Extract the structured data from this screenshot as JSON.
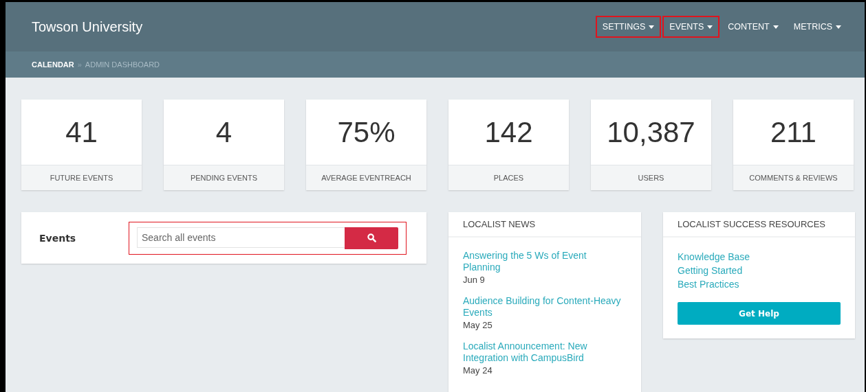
{
  "header": {
    "title": "Towson University",
    "nav": [
      {
        "label": "SETTINGS",
        "highlighted": true
      },
      {
        "label": "EVENTS",
        "highlighted": true
      },
      {
        "label": "CONTENT",
        "highlighted": false
      },
      {
        "label": "METRICS",
        "highlighted": false
      }
    ]
  },
  "breadcrumb": {
    "items": [
      "CALENDAR",
      "ADMIN DASHBOARD"
    ],
    "separator": "»"
  },
  "stats": [
    {
      "value": "41",
      "label": "FUTURE EVENTS"
    },
    {
      "value": "4",
      "label": "PENDING EVENTS"
    },
    {
      "value": "75%",
      "label": "AVERAGE EVENTREACH"
    },
    {
      "value": "142",
      "label": "PLACES"
    },
    {
      "value": "10,387",
      "label": "USERS"
    },
    {
      "value": "211",
      "label": "COMMENTS & REVIEWS"
    }
  ],
  "events_panel": {
    "title": "Events",
    "search": {
      "placeholder": "Search all events",
      "highlighted": true
    }
  },
  "news": {
    "title": "LOCALIST NEWS",
    "items": [
      {
        "title": "Answering the 5 Ws of Event Planning",
        "date": "Jun 9"
      },
      {
        "title": "Audience Building for Content-Heavy Events",
        "date": "May 25"
      },
      {
        "title": "Localist Announcement: New Integration with CampusBird",
        "date": "May 24"
      }
    ]
  },
  "resources": {
    "title": "LOCALIST SUCCESS RESOURCES",
    "links": [
      "Knowledge Base",
      "Getting Started",
      "Best Practices"
    ],
    "button": "Get Help"
  }
}
